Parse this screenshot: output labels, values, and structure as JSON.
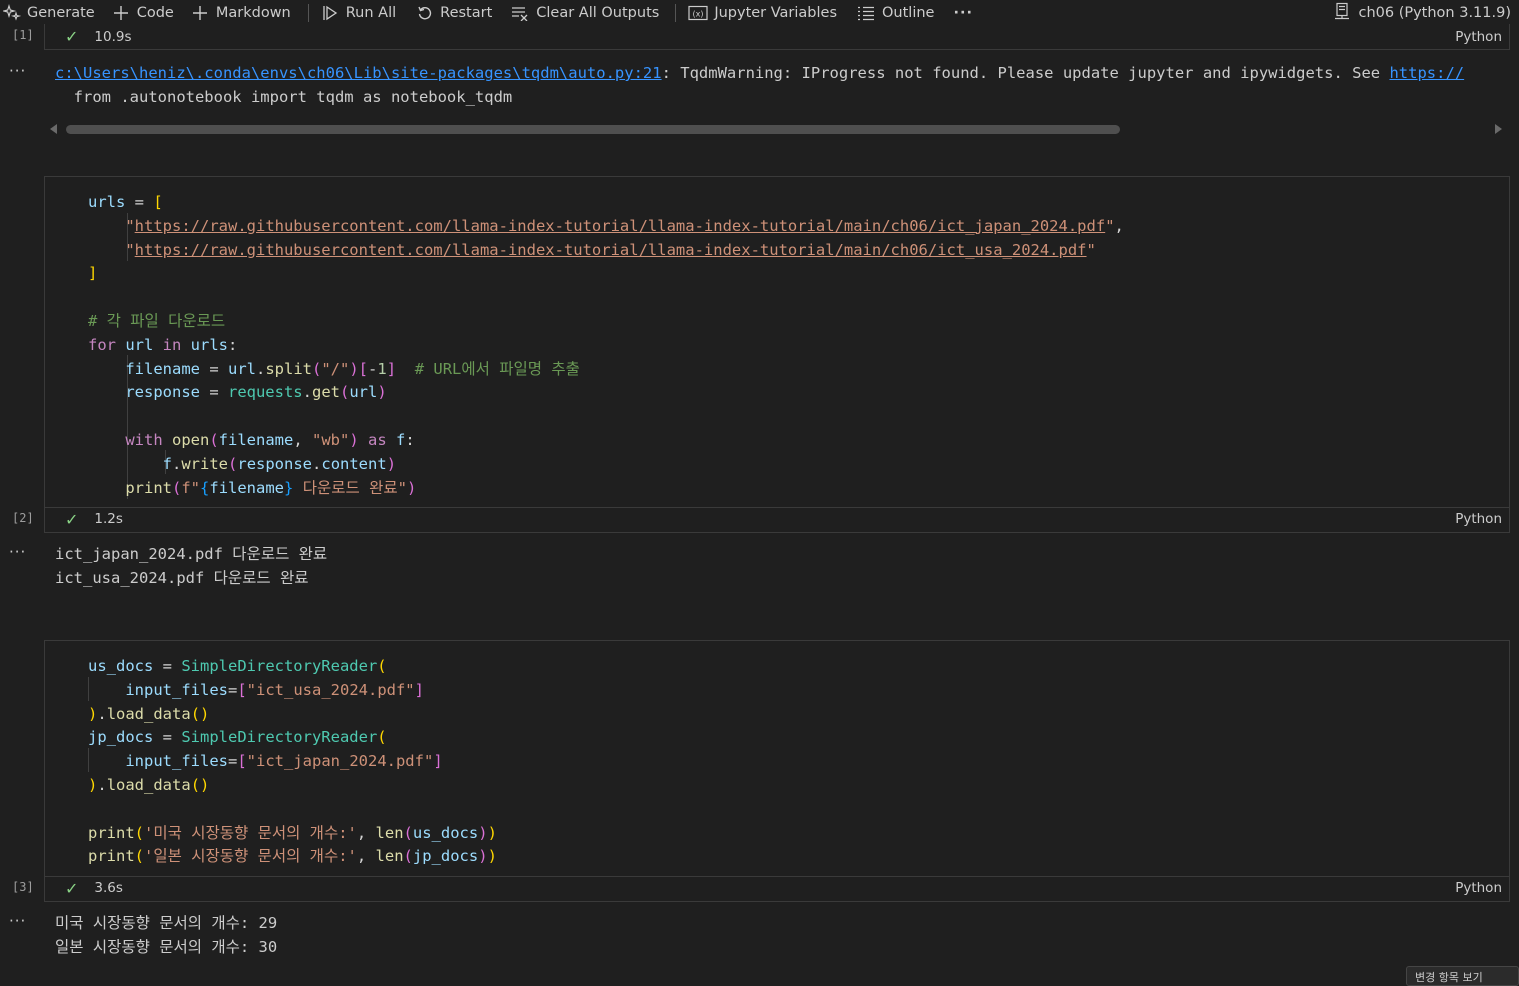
{
  "toolbar": {
    "generate": "Generate",
    "code": "Code",
    "markdown": "Markdown",
    "run_all": "Run All",
    "restart": "Restart",
    "clear_all_outputs": "Clear All Outputs",
    "jupyter_variables": "Jupyter Variables",
    "outline": "Outline",
    "more": "···",
    "kernel": "ch06 (Python 3.11.9)"
  },
  "cells": [
    {
      "exec_count": "[1]",
      "duration": "10.9s",
      "language": "Python",
      "output_ellipsis": "···",
      "output": {
        "warning_link": "c:\\Users\\heniz\\.conda\\envs\\ch06\\Lib\\site-packages\\tqdm\\auto.py:21",
        "warning_text": ": TqdmWarning: IProgress not found. Please update jupyter and ipywidgets. See ",
        "warning_url": "https://",
        "line2": "  from .autonotebook import tqdm as notebook_tqdm"
      }
    },
    {
      "exec_count": "[2]",
      "duration": "1.2s",
      "language": "Python",
      "output_ellipsis": "···",
      "code": {
        "urls_var": "urls",
        "url1": "https://raw.githubusercontent.com/llama-index-tutorial/llama-index-tutorial/main/ch06/ict_japan_2024.pdf",
        "url2": "https://raw.githubusercontent.com/llama-index-tutorial/llama-index-tutorial/main/ch06/ict_usa_2024.pdf",
        "comment1": "# 각 파일 다운로드",
        "comment2": "# URL에서 파일명 추출",
        "print_suffix": " 다운로드 완료"
      },
      "output_lines": [
        "ict_japan_2024.pdf 다운로드 완료",
        "ict_usa_2024.pdf 다운로드 완료"
      ]
    },
    {
      "exec_count": "[3]",
      "duration": "3.6s",
      "language": "Python",
      "output_ellipsis": "···",
      "code": {
        "us_file": "\"ict_usa_2024.pdf\"",
        "jp_file": "\"ict_japan_2024.pdf\"",
        "us_label": "'미국 시장동향 문서의 개수:'",
        "jp_label": "'일본 시장동향 문서의 개수:'"
      },
      "output_lines": [
        "미국 시장동향 문서의 개수: 29",
        "일본 시장동향 문서의 개수: 30"
      ]
    }
  ],
  "toast_text": "변경 항목 보기"
}
